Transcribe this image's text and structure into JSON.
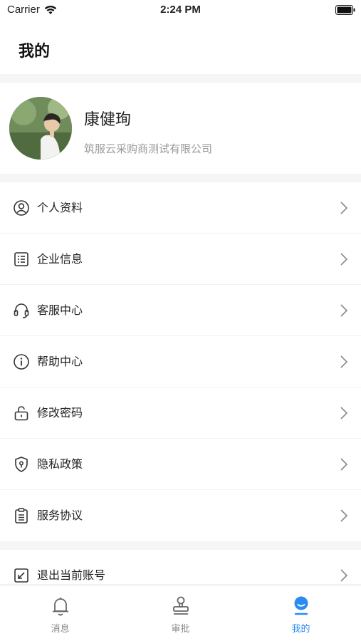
{
  "status_bar": {
    "carrier": "Carrier",
    "time": "2:24 PM"
  },
  "header": {
    "title": "我的"
  },
  "profile": {
    "name": "康健珣",
    "company": "筑服云采购商测试有限公司"
  },
  "menu": {
    "items": [
      {
        "label": "个人资料",
        "icon": "user-circle-icon"
      },
      {
        "label": "企业信息",
        "icon": "list-icon"
      },
      {
        "label": "客服中心",
        "icon": "headset-icon"
      },
      {
        "label": "帮助中心",
        "icon": "info-icon"
      },
      {
        "label": "修改密码",
        "icon": "lock-open-icon"
      },
      {
        "label": "隐私政策",
        "icon": "shield-icon"
      },
      {
        "label": "服务协议",
        "icon": "clipboard-icon"
      }
    ]
  },
  "logout": {
    "label": "退出当前账号",
    "icon": "exit-icon"
  },
  "tabs": [
    {
      "label": "消息",
      "icon": "bell-icon",
      "active": false
    },
    {
      "label": "审批",
      "icon": "stamp-icon",
      "active": false
    },
    {
      "label": "我的",
      "icon": "profile-icon",
      "active": true
    }
  ],
  "colors": {
    "accent": "#2a8cf0",
    "secondary_text": "#9a9a9a",
    "background": "#f5f5f5"
  }
}
